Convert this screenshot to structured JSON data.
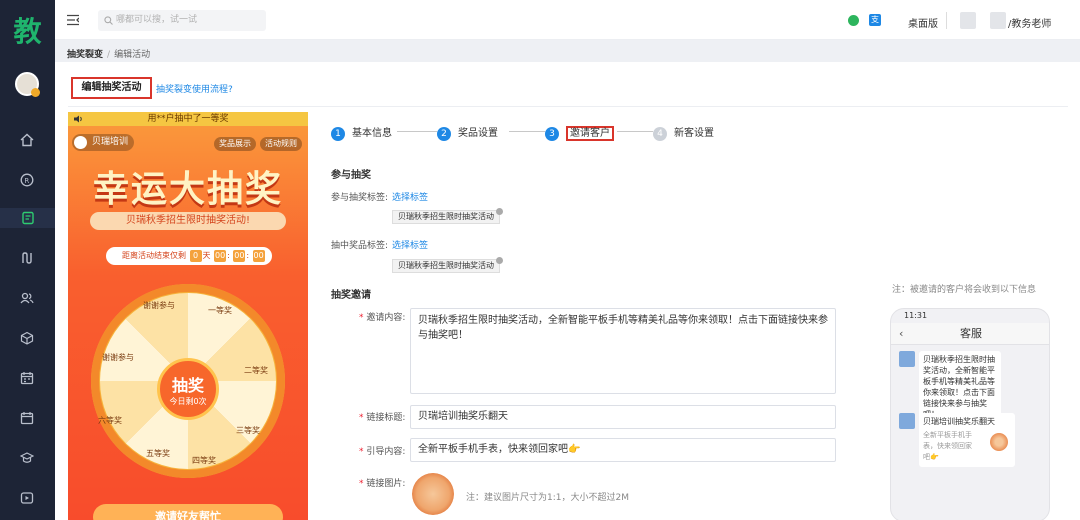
{
  "app": {
    "logo_char": "教"
  },
  "topbar": {
    "search_placeholder": "哪都可以搜，试一试",
    "badge_icon_text": "支",
    "desktop_label": "桌面版",
    "user_role": "/教务老师"
  },
  "breadcrumb": {
    "parent": "抽奖裂变",
    "separator": "/",
    "current": "编辑活动"
  },
  "actions": {
    "edit_btn": "编辑抽奖活动",
    "flow_link": "抽奖裂变使用流程?"
  },
  "preview": {
    "notice": "用**户抽中了一等奖",
    "brand": "贝瑞培训",
    "btn_prizes": "奖品展示",
    "btn_rules": "活动规则",
    "title": "幸运大抽奖",
    "subtitle": "贝瑞秋季招生限时抽奖活动!",
    "countdown_label": "距离活动结束仅剩",
    "countdown": {
      "days": "0",
      "d_unit": "天",
      "h": "00",
      "m": "00",
      "s": "00",
      "sep": ":"
    },
    "wheel_segments": [
      "谢谢参与",
      "一等奖",
      "二等奖",
      "三等奖",
      "四等奖",
      "五等奖",
      "六等奖",
      "谢谢参与"
    ],
    "hub_title": "抽奖",
    "hub_sub": "今日剩0次",
    "invite_btn": "邀请好友帮忙"
  },
  "steps": [
    {
      "num": "1",
      "label": "基本信息",
      "state": "done"
    },
    {
      "num": "2",
      "label": "奖品设置",
      "state": "done"
    },
    {
      "num": "3",
      "label": "邀请客户",
      "state": "current"
    },
    {
      "num": "4",
      "label": "新客设置",
      "state": "todo"
    }
  ],
  "form": {
    "sec_participate": "参与抽奖",
    "participate_tag_label": "参与抽奖标签:",
    "choose_tag": "选择标签",
    "participate_tag": "贝瑞秋季招生限时抽奖活动",
    "win_tag_label": "抽中奖品标签:",
    "win_tag": "贝瑞秋季招生限时抽奖活动",
    "sec_invite": "抽奖邀请",
    "invite_label": "邀请内容:",
    "invite_content": "贝瑞秋季招生限时抽奖活动，全新智能平板手机等精美礼品等你来领取！点击下面链接快来参与抽奖吧！",
    "link_title_label": "链接标题:",
    "link_title": "贝瑞培训抽奖乐翻天",
    "guide_label": "引导内容:",
    "guide": "全新平板手机手表，快来领回家吧",
    "guide_emoji": "👉",
    "image_label": "链接图片:",
    "image_hint": "注：建议图片尺寸为1:1，大小不超过2M",
    "required_mark": "*"
  },
  "mobile": {
    "note": "注：被邀请的客户将会收到以下信息",
    "time": "11:31",
    "chat_title": "客服",
    "back": "‹",
    "message": "贝瑞秋季招生限时抽奖活动，全新智能平板手机等精美礼品等你来领取！点击下面链接快来参与抽奖吧！",
    "card_title": "贝瑞培训抽奖乐翻天",
    "card_desc": "全新平板手机手表，快来领回家吧👉"
  },
  "colors": {
    "sidebar": "#1d2436",
    "accent": "#1e88e5",
    "highlight": "#d9352b",
    "brand_green": "#1fb46d"
  }
}
